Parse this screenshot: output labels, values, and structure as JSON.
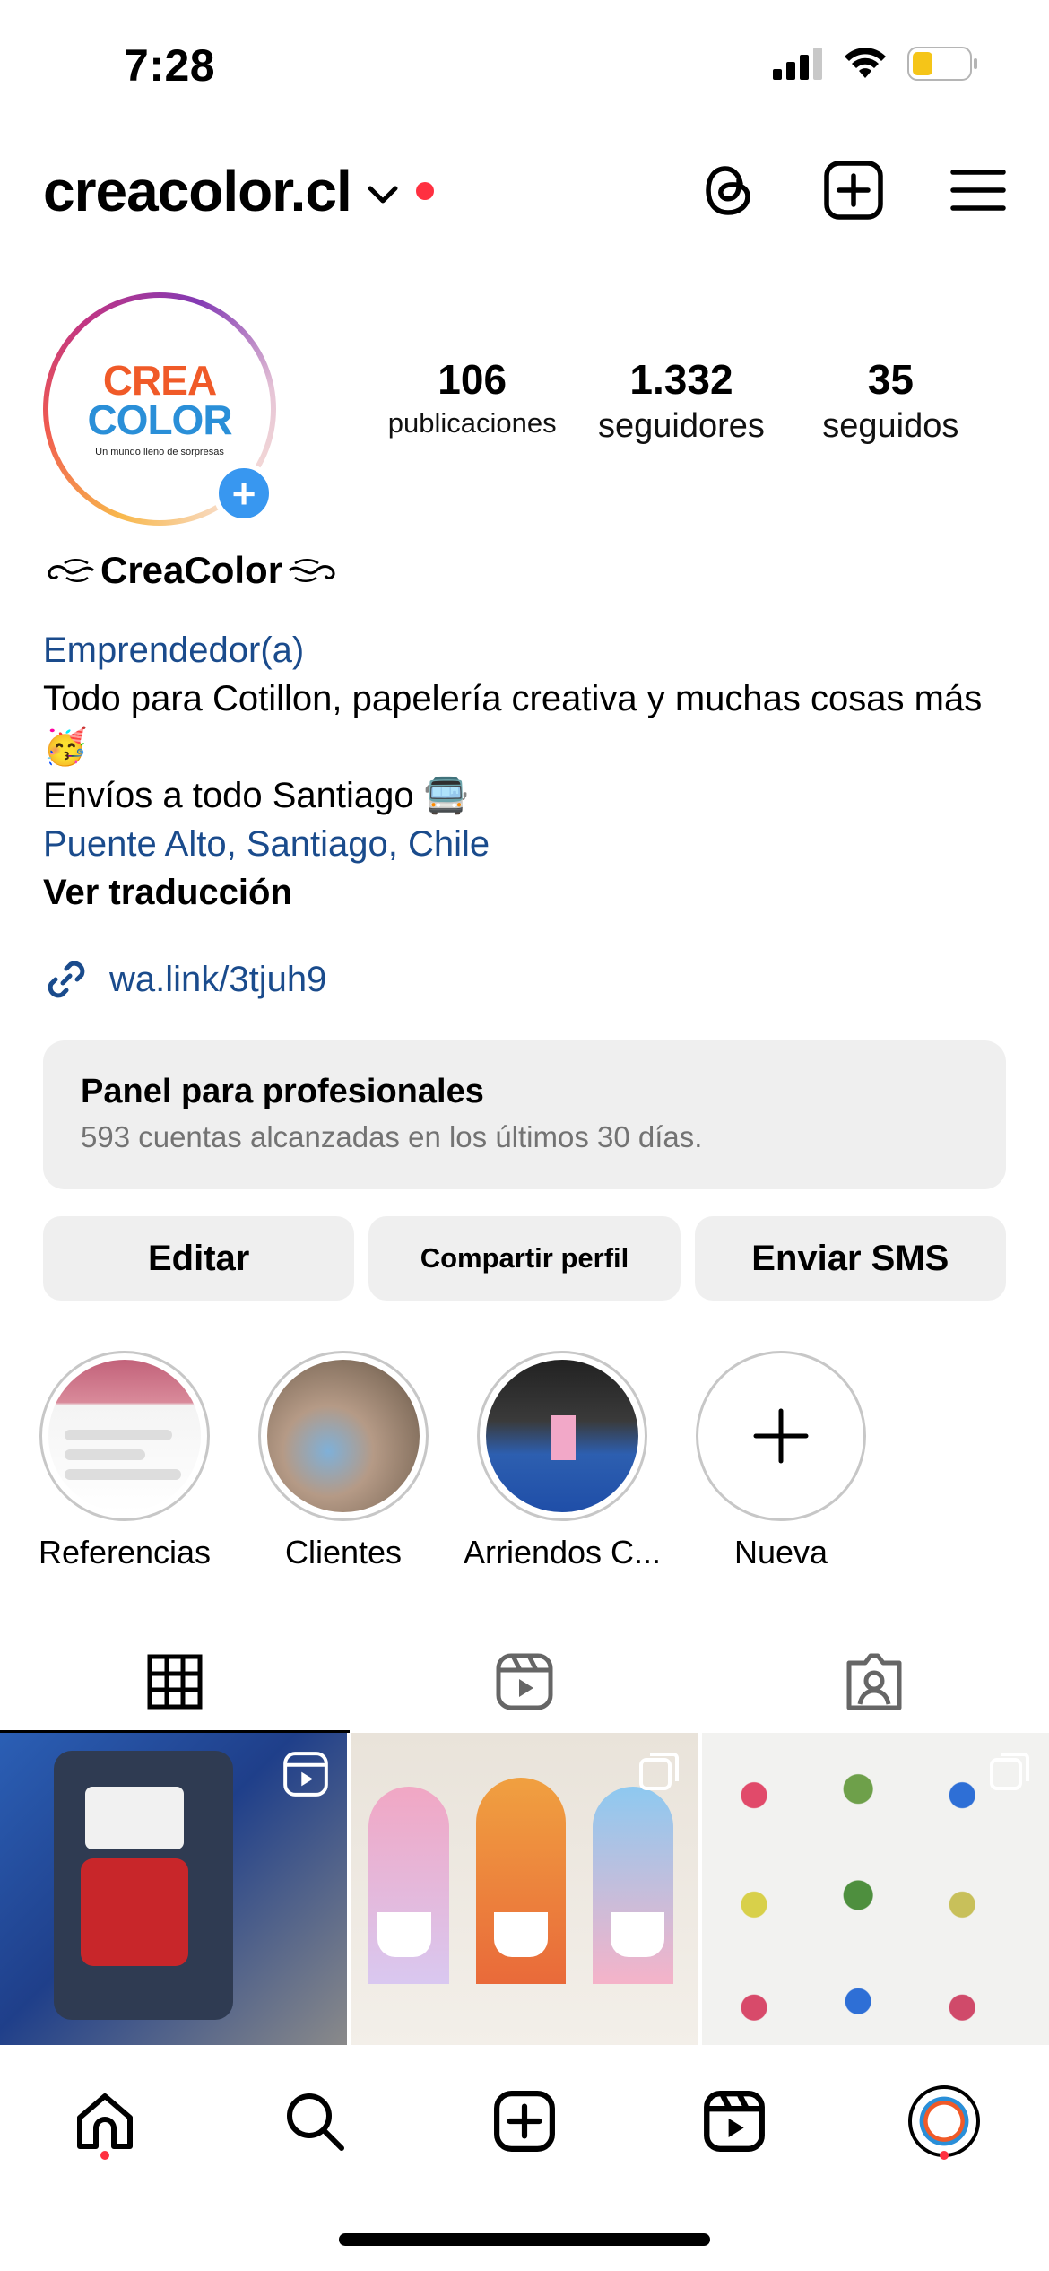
{
  "status_bar": {
    "time": "7:28",
    "signal": "signal-icon",
    "wifi": "wifi-icon",
    "battery": "battery-icon"
  },
  "header": {
    "username": "creacolor.cl",
    "icons": [
      "threads-icon",
      "new-post-icon",
      "menu-icon"
    ]
  },
  "profile": {
    "avatar_text": {
      "line1": "CREA",
      "line2": "COLOR",
      "tagline": "Un mundo lleno de sorpresas"
    },
    "stats": [
      {
        "value": "106",
        "label": "publicaciones"
      },
      {
        "value": "1.332",
        "label": "seguidores"
      },
      {
        "value": "35",
        "label": "seguidos"
      }
    ],
    "display_name": "CreaColor",
    "category": "Emprendedor(a)",
    "bio_line1": "Todo para Cotillon, papelería creativa y muchas cosas más 🥳",
    "bio_line2": "Envíos a todo Santiago 🚍",
    "location": "Puente Alto, Santiago, Chile",
    "translate": "Ver traducción",
    "link": "wa.link/3tjuh9"
  },
  "panel": {
    "title": "Panel para profesionales",
    "subtitle": "593 cuentas alcanzadas en los últimos 30 días."
  },
  "buttons": {
    "edit": "Editar",
    "share": "Compartir perfil",
    "sms": "Enviar SMS"
  },
  "highlights": [
    {
      "label": "Referencias"
    },
    {
      "label": "Clientes"
    },
    {
      "label": "Arriendos C..."
    },
    {
      "label": "Nueva"
    }
  ],
  "tabs": [
    "grid-icon",
    "reels-icon",
    "tagged-icon"
  ],
  "nav": [
    "home-icon",
    "search-icon",
    "create-icon",
    "reels-icon",
    "profile-avatar"
  ],
  "colors": {
    "link_blue": "#1a4b8c",
    "notification_red": "#ff3040",
    "panel_bg": "#efefef",
    "add_blue": "#3897f0"
  }
}
